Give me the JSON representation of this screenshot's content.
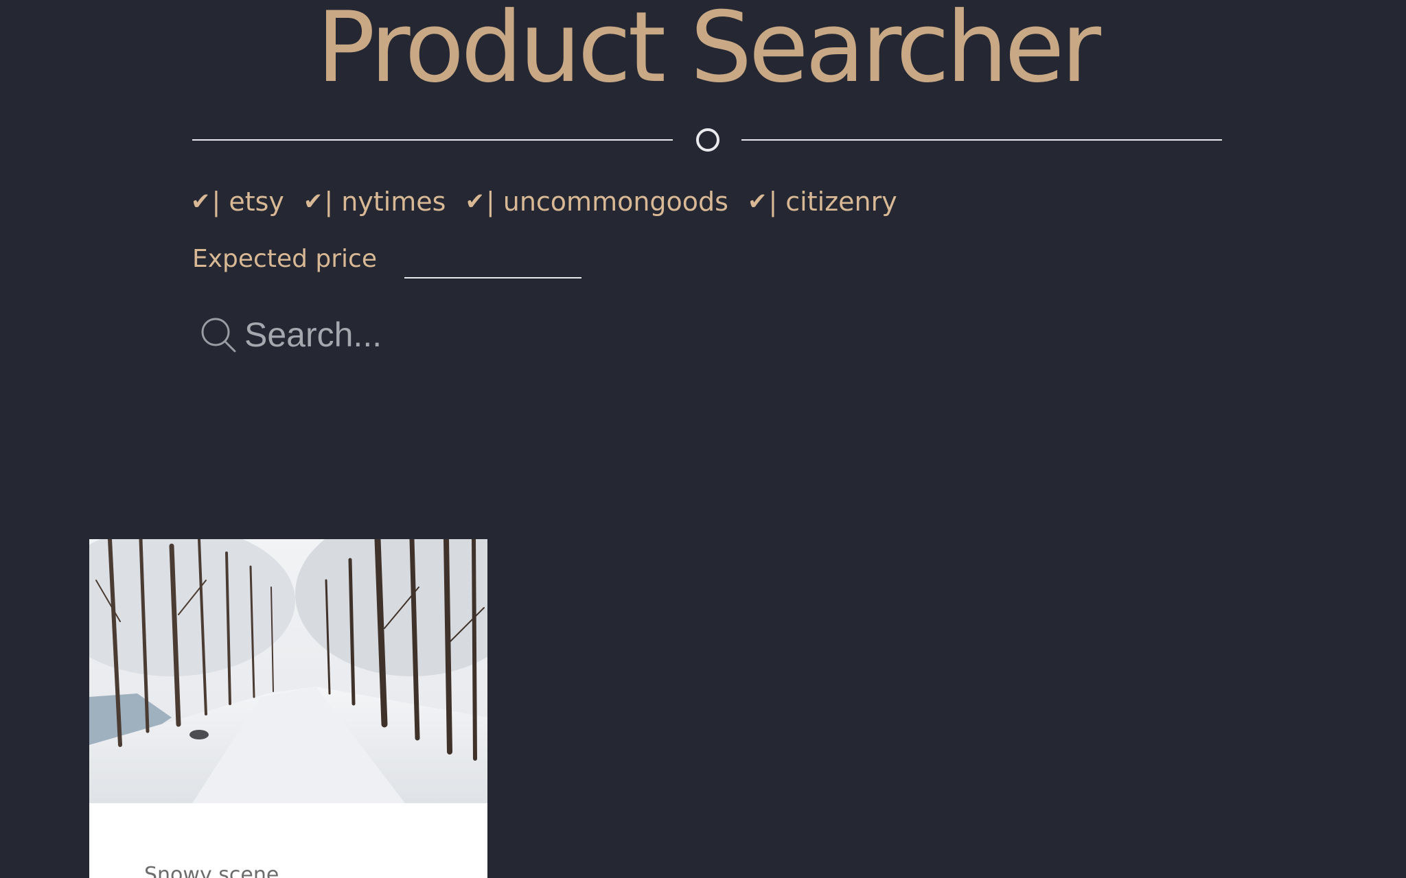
{
  "header": {
    "title": "Product Searcher"
  },
  "sources": [
    {
      "check": "✔",
      "label": "etsy"
    },
    {
      "check": "✔",
      "label": "nytimes"
    },
    {
      "check": "✔",
      "label": "uncommongoods"
    },
    {
      "check": "✔",
      "label": "citizenry"
    }
  ],
  "price": {
    "label": "Expected price",
    "value": ""
  },
  "search": {
    "placeholder": "Search...",
    "icon": "search-icon"
  },
  "results": [
    {
      "title": "Snowy scene",
      "image": "snowy-forest-road"
    }
  ],
  "colors": {
    "background": "#252832",
    "accent": "#c9a886",
    "text_accent": "#d9b995",
    "line": "#e9e9ee"
  }
}
